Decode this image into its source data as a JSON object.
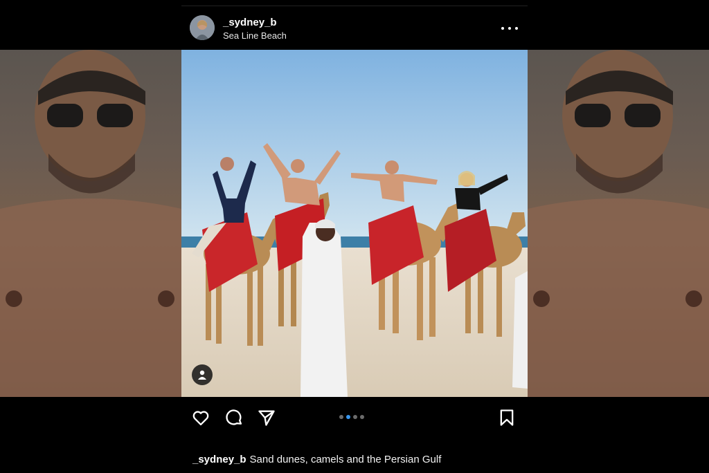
{
  "post": {
    "username": "_sydney_b",
    "location": "Sea Line Beach",
    "caption_user": "_sydney_b",
    "caption_text": "Sand dunes, camels and the Persian Gulf"
  },
  "carousel": {
    "count": 4,
    "active_index": 1
  },
  "icons": {
    "more": "more-options-icon",
    "like": "heart-icon",
    "comment": "comment-icon",
    "share": "send-icon",
    "save": "bookmark-icon",
    "tag": "user-tag-icon"
  },
  "colors": {
    "accent": "#3897f0",
    "background": "#000000"
  }
}
